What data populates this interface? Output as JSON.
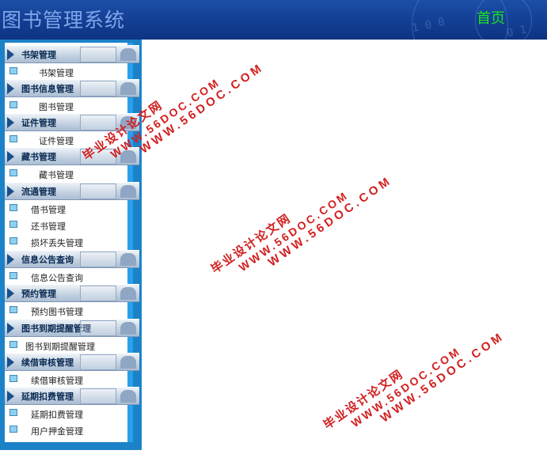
{
  "app": {
    "title": "图书管理系统",
    "home_link": "首页"
  },
  "header_deco": {
    "numbers": [
      "1 0 0",
      "0 1"
    ]
  },
  "sidebar": {
    "groups": [
      {
        "title": "书架管理",
        "items": [
          "书架管理"
        ]
      },
      {
        "title": "图书信息管理",
        "items": [
          "图书管理"
        ]
      },
      {
        "title": "证件管理",
        "items": [
          "证件管理"
        ]
      },
      {
        "title": "藏书管理",
        "items": [
          "藏书管理"
        ]
      },
      {
        "title": "流通管理",
        "items": [
          "借书管理",
          "还书管理",
          "损坏丢失管理"
        ]
      },
      {
        "title": "信息公告查询",
        "items": [
          "信息公告查询"
        ]
      },
      {
        "title": "预约管理",
        "items": [
          "预约图书管理"
        ]
      },
      {
        "title": "图书到期提醒管理",
        "items": [
          "图书到期提醒管理"
        ]
      },
      {
        "title": "续借审核管理",
        "items": [
          "续借审核管理"
        ]
      },
      {
        "title": "延期扣费管理",
        "items": [
          "延期扣费管理",
          "用户押金管理"
        ]
      }
    ]
  },
  "watermark": {
    "cn": "毕业设计论文网",
    "en": "WWW.56DOC.COM",
    "domain": "WWW.56DOC.COM",
    "color": "#d21f1f"
  }
}
